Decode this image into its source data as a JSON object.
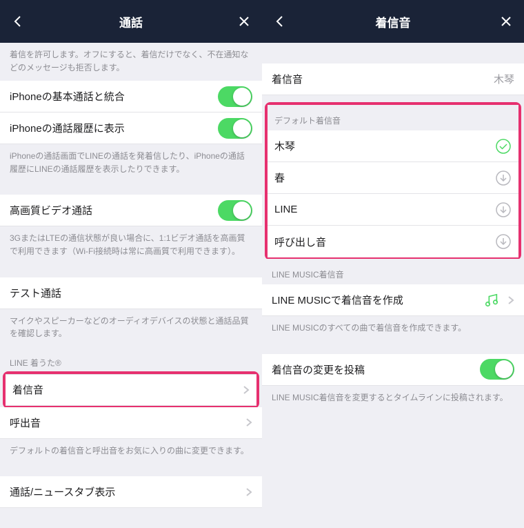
{
  "left": {
    "title": "通話",
    "desc1": "着信を許可します。オフにすると、着信だけでなく、不在通知などのメッセージも拒否します。",
    "row_integrate": "iPhoneの基本通話と統合",
    "row_history": "iPhoneの通話履歴に表示",
    "desc2": "iPhoneの通話画面でLINEの通話を発着信したり、iPhoneの通話履歴にLINEの通話履歴を表示したりできます。",
    "row_hq": "高画質ビデオ通話",
    "desc3": "3GまたはLTEの通信状態が良い場合に、1:1ビデオ通話を高画質で利用できます（Wi-Fi接続時は常に高画質で利用できます）。",
    "row_test": "テスト通話",
    "desc4": "マイクやスピーカーなどのオーディオデバイスの状態と通話品質を確認します。",
    "section_ringtone": "LINE 着うた®",
    "row_ringtone": "着信音",
    "row_ringback": "呼出音",
    "desc5": "デフォルトの着信音と呼出音をお気に入りの曲に変更できます。",
    "row_newstab": "通話/ニュースタブ表示"
  },
  "right": {
    "title": "着信音",
    "row_ringtone": "着信音",
    "ringtone_value": "木琴",
    "section_default": "デフォルト着信音",
    "opt1": "木琴",
    "opt2": "春",
    "opt3": "LINE",
    "opt4": "呼び出し音",
    "section_music": "LINE MUSIC着信音",
    "row_music": "LINE MUSICで着信音を作成",
    "desc_music": "LINE MUSICのすべての曲で着信音を作成できます。",
    "row_post": "着信音の変更を投稿",
    "desc_post": "LINE MUSIC着信音を変更するとタイムラインに投稿されます。"
  }
}
